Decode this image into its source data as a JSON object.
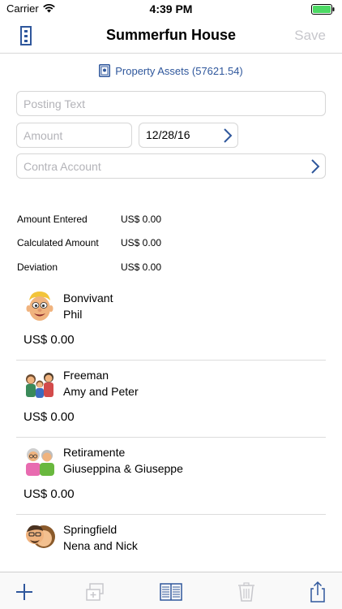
{
  "status": {
    "carrier": "Carrier",
    "time": "4:39 PM"
  },
  "nav": {
    "title": "Summerfun House",
    "save_label": "Save"
  },
  "account": {
    "label": "Property Assets (57621.54)"
  },
  "form": {
    "posting_text_placeholder": "Posting Text",
    "amount_placeholder": "Amount",
    "date_value": "12/28/16",
    "contra_placeholder": "Contra Account"
  },
  "summary": [
    {
      "label": "Amount Entered",
      "value": "US$ 0.00"
    },
    {
      "label": "Calculated Amount",
      "value": "US$ 0.00"
    },
    {
      "label": "Deviation",
      "value": "US$ 0.00"
    }
  ],
  "members": [
    {
      "last": "Bonvivant",
      "first": "Phil",
      "amount": "US$ 0.00"
    },
    {
      "last": "Freeman",
      "first": "Amy and Peter",
      "amount": "US$ 0.00"
    },
    {
      "last": "Retiramente",
      "first": "Giuseppina & Giuseppe",
      "amount": "US$ 0.00"
    },
    {
      "last": "Springfield",
      "first": "Nena and Nick",
      "amount": ""
    }
  ],
  "toolbar": {
    "icons": [
      "plus-icon",
      "duplicate-icon",
      "book-icon",
      "trash-icon",
      "share-icon"
    ]
  },
  "colors": {
    "accent": "#2f579c",
    "disabled": "#c7c7cc"
  }
}
